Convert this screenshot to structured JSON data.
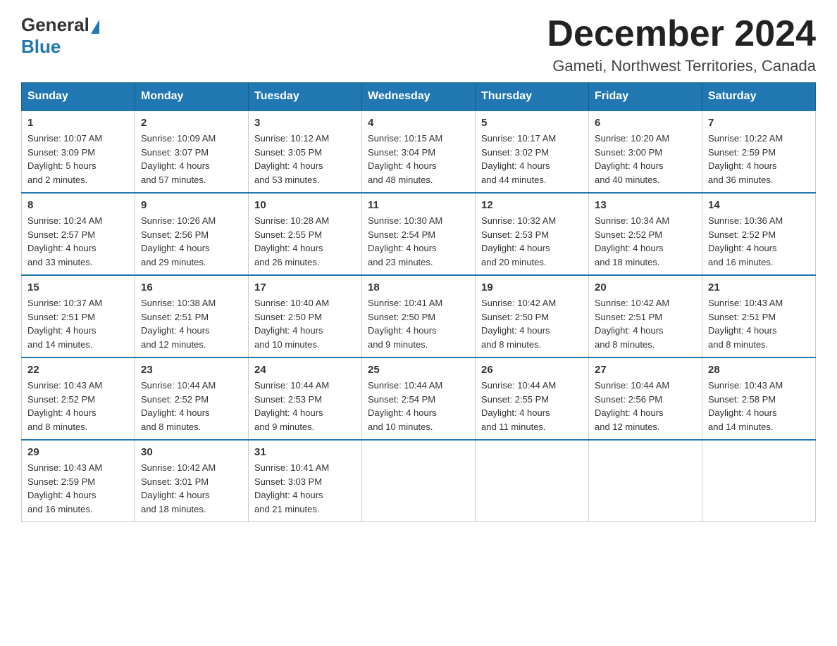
{
  "header": {
    "logo_general": "General",
    "logo_blue": "Blue",
    "month_title": "December 2024",
    "location": "Gameti, Northwest Territories, Canada"
  },
  "weekdays": [
    "Sunday",
    "Monday",
    "Tuesday",
    "Wednesday",
    "Thursday",
    "Friday",
    "Saturday"
  ],
  "weeks": [
    [
      {
        "day": "1",
        "sunrise": "Sunrise: 10:07 AM",
        "sunset": "Sunset: 3:09 PM",
        "daylight": "Daylight: 5 hours",
        "daylight2": "and 2 minutes."
      },
      {
        "day": "2",
        "sunrise": "Sunrise: 10:09 AM",
        "sunset": "Sunset: 3:07 PM",
        "daylight": "Daylight: 4 hours",
        "daylight2": "and 57 minutes."
      },
      {
        "day": "3",
        "sunrise": "Sunrise: 10:12 AM",
        "sunset": "Sunset: 3:05 PM",
        "daylight": "Daylight: 4 hours",
        "daylight2": "and 53 minutes."
      },
      {
        "day": "4",
        "sunrise": "Sunrise: 10:15 AM",
        "sunset": "Sunset: 3:04 PM",
        "daylight": "Daylight: 4 hours",
        "daylight2": "and 48 minutes."
      },
      {
        "day": "5",
        "sunrise": "Sunrise: 10:17 AM",
        "sunset": "Sunset: 3:02 PM",
        "daylight": "Daylight: 4 hours",
        "daylight2": "and 44 minutes."
      },
      {
        "day": "6",
        "sunrise": "Sunrise: 10:20 AM",
        "sunset": "Sunset: 3:00 PM",
        "daylight": "Daylight: 4 hours",
        "daylight2": "and 40 minutes."
      },
      {
        "day": "7",
        "sunrise": "Sunrise: 10:22 AM",
        "sunset": "Sunset: 2:59 PM",
        "daylight": "Daylight: 4 hours",
        "daylight2": "and 36 minutes."
      }
    ],
    [
      {
        "day": "8",
        "sunrise": "Sunrise: 10:24 AM",
        "sunset": "Sunset: 2:57 PM",
        "daylight": "Daylight: 4 hours",
        "daylight2": "and 33 minutes."
      },
      {
        "day": "9",
        "sunrise": "Sunrise: 10:26 AM",
        "sunset": "Sunset: 2:56 PM",
        "daylight": "Daylight: 4 hours",
        "daylight2": "and 29 minutes."
      },
      {
        "day": "10",
        "sunrise": "Sunrise: 10:28 AM",
        "sunset": "Sunset: 2:55 PM",
        "daylight": "Daylight: 4 hours",
        "daylight2": "and 26 minutes."
      },
      {
        "day": "11",
        "sunrise": "Sunrise: 10:30 AM",
        "sunset": "Sunset: 2:54 PM",
        "daylight": "Daylight: 4 hours",
        "daylight2": "and 23 minutes."
      },
      {
        "day": "12",
        "sunrise": "Sunrise: 10:32 AM",
        "sunset": "Sunset: 2:53 PM",
        "daylight": "Daylight: 4 hours",
        "daylight2": "and 20 minutes."
      },
      {
        "day": "13",
        "sunrise": "Sunrise: 10:34 AM",
        "sunset": "Sunset: 2:52 PM",
        "daylight": "Daylight: 4 hours",
        "daylight2": "and 18 minutes."
      },
      {
        "day": "14",
        "sunrise": "Sunrise: 10:36 AM",
        "sunset": "Sunset: 2:52 PM",
        "daylight": "Daylight: 4 hours",
        "daylight2": "and 16 minutes."
      }
    ],
    [
      {
        "day": "15",
        "sunrise": "Sunrise: 10:37 AM",
        "sunset": "Sunset: 2:51 PM",
        "daylight": "Daylight: 4 hours",
        "daylight2": "and 14 minutes."
      },
      {
        "day": "16",
        "sunrise": "Sunrise: 10:38 AM",
        "sunset": "Sunset: 2:51 PM",
        "daylight": "Daylight: 4 hours",
        "daylight2": "and 12 minutes."
      },
      {
        "day": "17",
        "sunrise": "Sunrise: 10:40 AM",
        "sunset": "Sunset: 2:50 PM",
        "daylight": "Daylight: 4 hours",
        "daylight2": "and 10 minutes."
      },
      {
        "day": "18",
        "sunrise": "Sunrise: 10:41 AM",
        "sunset": "Sunset: 2:50 PM",
        "daylight": "Daylight: 4 hours",
        "daylight2": "and 9 minutes."
      },
      {
        "day": "19",
        "sunrise": "Sunrise: 10:42 AM",
        "sunset": "Sunset: 2:50 PM",
        "daylight": "Daylight: 4 hours",
        "daylight2": "and 8 minutes."
      },
      {
        "day": "20",
        "sunrise": "Sunrise: 10:42 AM",
        "sunset": "Sunset: 2:51 PM",
        "daylight": "Daylight: 4 hours",
        "daylight2": "and 8 minutes."
      },
      {
        "day": "21",
        "sunrise": "Sunrise: 10:43 AM",
        "sunset": "Sunset: 2:51 PM",
        "daylight": "Daylight: 4 hours",
        "daylight2": "and 8 minutes."
      }
    ],
    [
      {
        "day": "22",
        "sunrise": "Sunrise: 10:43 AM",
        "sunset": "Sunset: 2:52 PM",
        "daylight": "Daylight: 4 hours",
        "daylight2": "and 8 minutes."
      },
      {
        "day": "23",
        "sunrise": "Sunrise: 10:44 AM",
        "sunset": "Sunset: 2:52 PM",
        "daylight": "Daylight: 4 hours",
        "daylight2": "and 8 minutes."
      },
      {
        "day": "24",
        "sunrise": "Sunrise: 10:44 AM",
        "sunset": "Sunset: 2:53 PM",
        "daylight": "Daylight: 4 hours",
        "daylight2": "and 9 minutes."
      },
      {
        "day": "25",
        "sunrise": "Sunrise: 10:44 AM",
        "sunset": "Sunset: 2:54 PM",
        "daylight": "Daylight: 4 hours",
        "daylight2": "and 10 minutes."
      },
      {
        "day": "26",
        "sunrise": "Sunrise: 10:44 AM",
        "sunset": "Sunset: 2:55 PM",
        "daylight": "Daylight: 4 hours",
        "daylight2": "and 11 minutes."
      },
      {
        "day": "27",
        "sunrise": "Sunrise: 10:44 AM",
        "sunset": "Sunset: 2:56 PM",
        "daylight": "Daylight: 4 hours",
        "daylight2": "and 12 minutes."
      },
      {
        "day": "28",
        "sunrise": "Sunrise: 10:43 AM",
        "sunset": "Sunset: 2:58 PM",
        "daylight": "Daylight: 4 hours",
        "daylight2": "and 14 minutes."
      }
    ],
    [
      {
        "day": "29",
        "sunrise": "Sunrise: 10:43 AM",
        "sunset": "Sunset: 2:59 PM",
        "daylight": "Daylight: 4 hours",
        "daylight2": "and 16 minutes."
      },
      {
        "day": "30",
        "sunrise": "Sunrise: 10:42 AM",
        "sunset": "Sunset: 3:01 PM",
        "daylight": "Daylight: 4 hours",
        "daylight2": "and 18 minutes."
      },
      {
        "day": "31",
        "sunrise": "Sunrise: 10:41 AM",
        "sunset": "Sunset: 3:03 PM",
        "daylight": "Daylight: 4 hours",
        "daylight2": "and 21 minutes."
      },
      null,
      null,
      null,
      null
    ]
  ]
}
